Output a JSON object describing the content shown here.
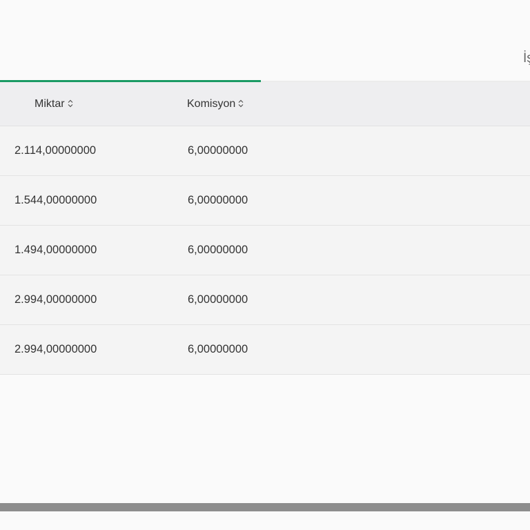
{
  "tabs": {
    "right_label": "İş"
  },
  "table": {
    "columns": [
      {
        "key": "miktar",
        "label": "Miktar"
      },
      {
        "key": "komisyon",
        "label": "Komisyon"
      }
    ],
    "rows": [
      {
        "miktar": "2.114,00000000",
        "komisyon": "6,00000000"
      },
      {
        "miktar": "1.544,00000000",
        "komisyon": "6,00000000"
      },
      {
        "miktar": "1.494,00000000",
        "komisyon": "6,00000000"
      },
      {
        "miktar": "2.994,00000000",
        "komisyon": "6,00000000"
      },
      {
        "miktar": "2.994,00000000",
        "komisyon": "6,00000000"
      }
    ]
  },
  "colors": {
    "accent": "#1a9a64",
    "header_bg": "#eeeef0",
    "row_bg": "#f4f4f4",
    "scroll_thumb": "#8d8d8d"
  },
  "icons": {
    "sort": "sort-icon"
  }
}
